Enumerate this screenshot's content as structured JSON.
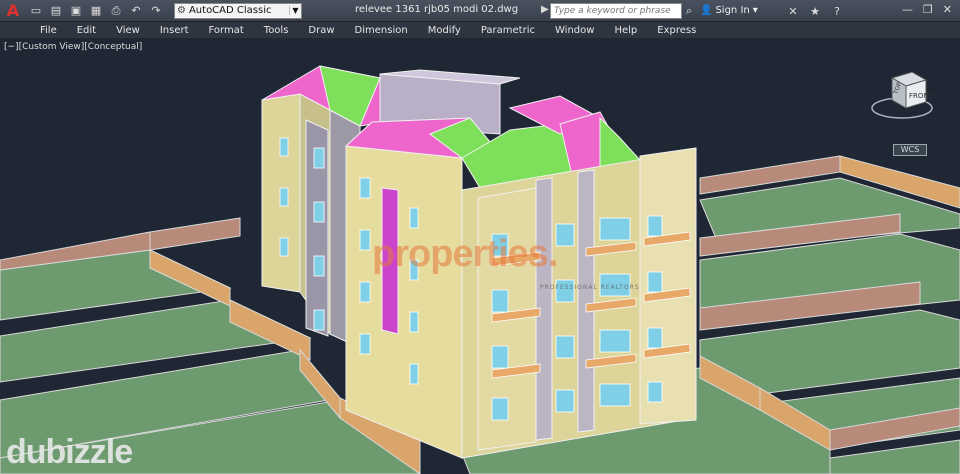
{
  "titlebar": {
    "app_icon": "autocad-logo",
    "workspace": "AutoCAD Classic",
    "document": "relevee 1361 rjb05 modi 02.dwg",
    "search_placeholder": "Type a keyword or phrase",
    "sign_in": "Sign In"
  },
  "menu": [
    "File",
    "Edit",
    "View",
    "Insert",
    "Format",
    "Tools",
    "Draw",
    "Dimension",
    "Modify",
    "Parametric",
    "Window",
    "Help",
    "Express"
  ],
  "viewport": {
    "label": "[−][Custom View][Conceptual]",
    "viewcube_face": "FRONT",
    "viewcube_top": "TOP",
    "wcs": "WCS"
  },
  "watermarks": {
    "properties": "properties.",
    "properties_tagline": "PROFESSIONAL REALTORS",
    "dubizzle": "dubizzle"
  },
  "colors": {
    "background": "#1e2733",
    "roof_magenta": "#ee66cc",
    "roof_green": "#7ee05a",
    "wall_beige": "#e6dc9e",
    "ground_green": "#6e9a70",
    "fence_brown": "#c9a070"
  }
}
